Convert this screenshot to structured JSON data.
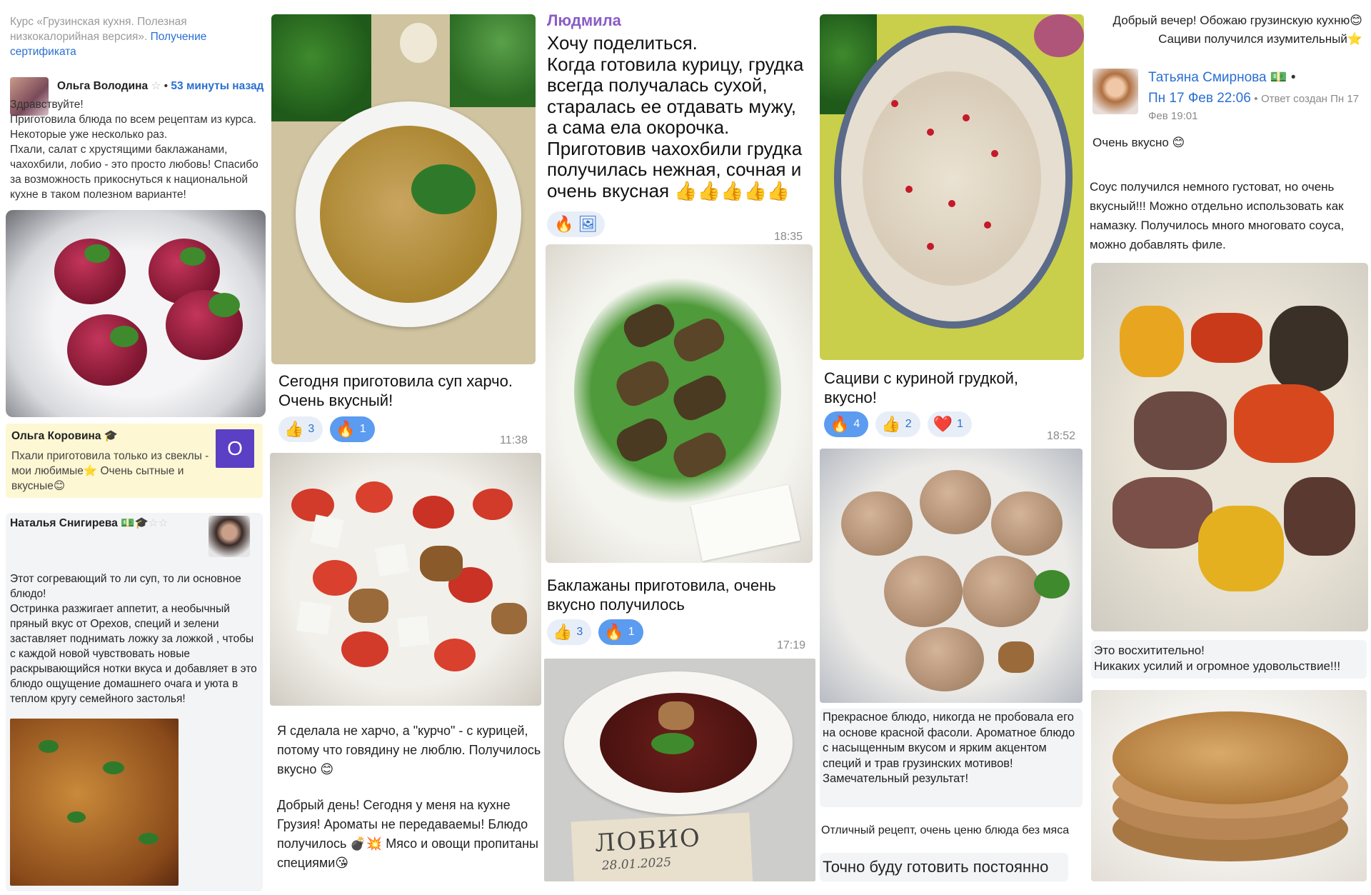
{
  "col1": {
    "course_prefix": "Курс «Грузинская кухня. Полезная низкокалорийная версия».",
    "course_link": "Получение сертификата",
    "post1": {
      "author": "Ольга Володина",
      "time": "53 минуты назад",
      "text": "Здравствуйте!\nПриготовила блюда по всем рецептам из курса. Некоторые уже несколько раз.\nПхали, салат с хрустящими баклажанами, чахохбили, лобио - это просто любовь! Спасибо за возможность прикоснуться к национальной кухне в таком полезном варианте!"
    },
    "post2": {
      "author": "Ольга Коровина",
      "avatar_letter": "О",
      "text": "Пхали приготовила только из свеклы - мои любимые⭐ Очень сытные и вкусные😊"
    },
    "post3": {
      "author": "Наталья Снигирева",
      "text": "Этот согревающий то ли суп, то ли основное блюдо!\nОстринка разжигает аппетит, а необычный пряный вкус от Орехов, специй и зелени заставляет поднимать ложку за ложкой , чтобы с каждой новой чувствовать новые раскрывающийся нотки вкуса и добавляет в это блюдо ощущение домашнего очага и уюта в теплом кругу семейного застолья!"
    }
  },
  "col2": {
    "post1": {
      "text": "Сегодня приготовила суп харчо.\nОчень вкусный!",
      "reactions": [
        {
          "emoji": "👍",
          "count": "3"
        },
        {
          "emoji": "🔥",
          "count": "1"
        }
      ],
      "time": "11:38"
    },
    "post2": {
      "text1": "Я сделала не харчо, а \"курчо\" - с курицей, потому что говядину не люблю. Получилось вкусно 😊",
      "text2": "Добрый день! Сегодня у меня на кухне Грузия! Ароматы не передаваемы! Блюдо получилось 💣💥 Мясо и овощи пропитаны специями😘"
    }
  },
  "col3": {
    "author": "Людмила",
    "text": "Хочу поделиться.\nКогда готовила курицу, грудка всегда получалась сухой, старалась ее отдавать мужу, а сама ела окорочка.\nПриготовив чахохбили грудка получилась нежная, сочная и очень вкусная 👍👍👍👍👍",
    "time1": "18:35",
    "text2": "Баклажаны приготовила, очень вкусно получилось",
    "reactions": [
      {
        "emoji": "👍",
        "count": "3"
      },
      {
        "emoji": "🔥",
        "count": "1"
      }
    ],
    "time2": "17:19",
    "label_card": "ЛОБИО",
    "label_date": "28.01.2025"
  },
  "col4": {
    "text1": "Сациви с куриной грудкой, вкусно!",
    "reactions": [
      {
        "emoji": "🔥",
        "count": "4"
      },
      {
        "emoji": "👍",
        "count": "2"
      },
      {
        "emoji": "❤️",
        "count": "1"
      }
    ],
    "time": "18:52",
    "text2": "Прекрасное блюдо, никогда не пробовала его на основе красной фасоли. Ароматное блюдо с насыщенным вкусом и ярким акцентом специй и трав грузинских мотивов!\nЗамечательный результат!",
    "text3": "Отличный рецепт, очень ценю блюда без мяса",
    "text4": "Точно буду готовить постоянно"
  },
  "col5": {
    "greeting": "Добрый вечер! Обожаю грузинскую кухню😊 Сациви получился изумительный⭐",
    "author": "Татьяна Смирнова",
    "date": "Пн 17 Фев 22:06",
    "reply_info": "Ответ создан Пн 17 Фев 19:01",
    "text1": "Очень вкусно 😊",
    "text2": "Соус получился немного густоват, но очень вкусный!!! Можно отдельно использовать как намазку. Получилось много многовато соуса, можно добавлять филе.",
    "text3": "Это восхитительно!\nНикаких усилий и огромное удовольствие!!!"
  },
  "colors": {
    "link": "#2a6fd1",
    "violet": "#5b3fc4",
    "name_purple": "#8a5cc8",
    "reaction_bg": "#e8eef7",
    "reaction_active": "#5b9bf0"
  }
}
